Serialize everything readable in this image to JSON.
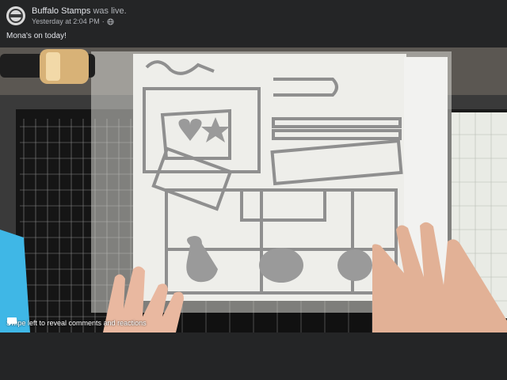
{
  "post": {
    "author": "Buffalo Stamps",
    "action": " was live.",
    "timestamp": "Yesterday at 2:04 PM",
    "separator": "·",
    "text": "Mona's on today!"
  },
  "video": {
    "overlay_hint": "Swipe left to reveal comments and reactions"
  },
  "icons": {
    "avatar": "buffalo-stamps-avatar",
    "privacy": "globe-icon",
    "comments": "speech-bubble-icon"
  },
  "colors": {
    "background": "#242526",
    "primary_text": "#e4e6eb",
    "secondary_text": "#b0b3b8"
  }
}
